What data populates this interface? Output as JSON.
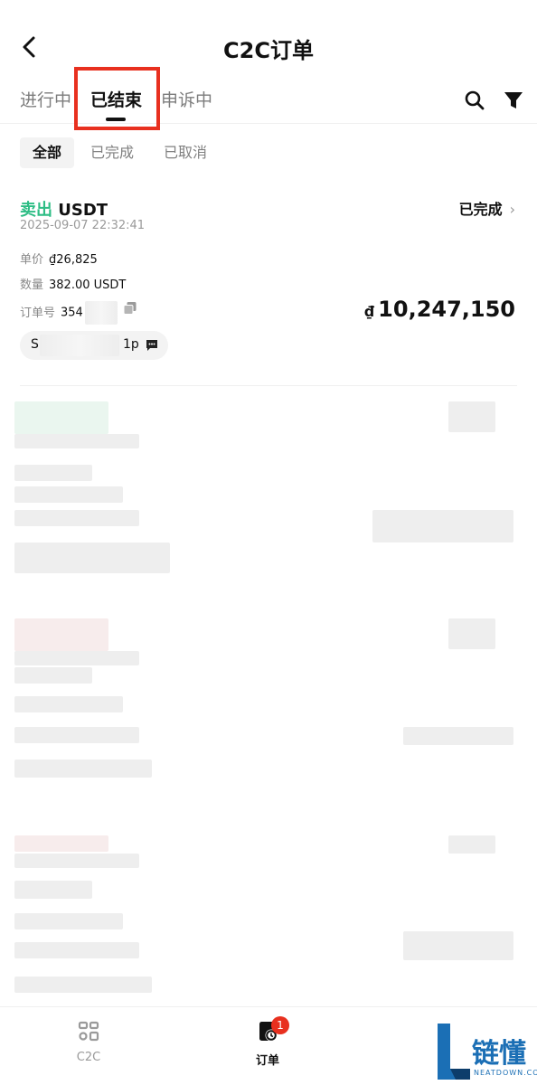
{
  "header": {
    "title": "C2C订单"
  },
  "tabs": [
    {
      "label": "进行中"
    },
    {
      "label": "已结束"
    },
    {
      "label": "申诉中"
    }
  ],
  "filters": [
    {
      "label": "全部"
    },
    {
      "label": "已完成"
    },
    {
      "label": "已取消"
    }
  ],
  "order": {
    "type_action": "卖出",
    "type_asset": "USDT",
    "time": "2025-09-07 22:32:41",
    "status": "已完成",
    "price_label": "单价",
    "price_value": "₫26,825",
    "qty_label": "数量",
    "qty_value": "382.00 USDT",
    "id_label": "订单号",
    "id_value": "354",
    "amount_currency": "₫",
    "amount_value": "10,247,150",
    "counterparty_start": "S",
    "counterparty_end": "1p"
  },
  "bottom_nav": [
    {
      "label": "C2C"
    },
    {
      "label": "订单",
      "badge": "1"
    }
  ],
  "watermark": {
    "text": "链懂",
    "sub": "NEATDOWN.COM"
  },
  "colors": {
    "accent_sell": "#2ebd85",
    "highlight": "#e8301f",
    "badge": "#e8301f",
    "watermark": "#1b6fb5"
  }
}
